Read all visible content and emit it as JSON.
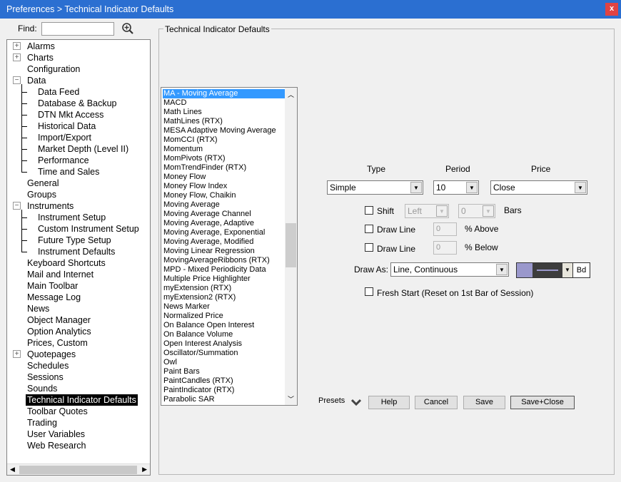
{
  "window": {
    "title": "Preferences > Technical Indicator Defaults",
    "close_label": "x"
  },
  "find": {
    "label": "Find:",
    "value": "",
    "icon": "zoom-in-icon"
  },
  "tree": [
    {
      "label": "Alarms",
      "level": 0,
      "expander": "+"
    },
    {
      "label": "Charts",
      "level": 0,
      "expander": "+"
    },
    {
      "label": "Configuration",
      "level": 0
    },
    {
      "label": "Data",
      "level": 0,
      "expander": "-"
    },
    {
      "label": "Data Feed",
      "level": 1
    },
    {
      "label": "Database & Backup",
      "level": 1
    },
    {
      "label": "DTN Mkt Access",
      "level": 1
    },
    {
      "label": "Historical Data",
      "level": 1
    },
    {
      "label": "Import/Export",
      "level": 1
    },
    {
      "label": "Market Depth (Level II)",
      "level": 1
    },
    {
      "label": "Performance",
      "level": 1
    },
    {
      "label": "Time and Sales",
      "level": 1
    },
    {
      "label": "General",
      "level": 0
    },
    {
      "label": "Groups",
      "level": 0
    },
    {
      "label": "Instruments",
      "level": 0,
      "expander": "-"
    },
    {
      "label": "Instrument Setup",
      "level": 1
    },
    {
      "label": "Custom Instrument Setup",
      "level": 1
    },
    {
      "label": "Future Type Setup",
      "level": 1
    },
    {
      "label": "Instrument Defaults",
      "level": 1
    },
    {
      "label": "Keyboard Shortcuts",
      "level": 0
    },
    {
      "label": "Mail and Internet",
      "level": 0
    },
    {
      "label": "Main Toolbar",
      "level": 0
    },
    {
      "label": "Message Log",
      "level": 0
    },
    {
      "label": "News",
      "level": 0
    },
    {
      "label": "Object Manager",
      "level": 0
    },
    {
      "label": "Option Analytics",
      "level": 0
    },
    {
      "label": "Prices, Custom",
      "level": 0
    },
    {
      "label": "Quotepages",
      "level": 0,
      "expander": "+"
    },
    {
      "label": "Schedules",
      "level": 0
    },
    {
      "label": "Sessions",
      "level": 0
    },
    {
      "label": "Sounds",
      "level": 0
    },
    {
      "label": "Technical Indicator Defaults",
      "level": 0,
      "selected": true
    },
    {
      "label": "Toolbar Quotes",
      "level": 0
    },
    {
      "label": "Trading",
      "level": 0
    },
    {
      "label": "User Variables",
      "level": 0
    },
    {
      "label": "Web Research",
      "level": 0
    }
  ],
  "group_title": "Technical Indicator Defaults",
  "indicators": {
    "selected": "MA - Moving Average",
    "items": [
      "MA - Moving Average",
      "MACD",
      "Math Lines",
      "MathLines (RTX)",
      "MESA Adaptive Moving Average",
      "MomCCI (RTX)",
      "Momentum",
      "MomPivots (RTX)",
      "MomTrendFinder (RTX)",
      "Money Flow",
      "Money Flow Index",
      "Money Flow, Chaikin",
      "Moving Average",
      "Moving Average Channel",
      "Moving Average, Adaptive",
      "Moving Average, Exponential",
      "Moving Average, Modified",
      "Moving Linear Regression",
      "MovingAverageRibbons (RTX)",
      "MPD - Mixed Periodicity Data",
      "Multiple Price Highlighter",
      "myExtension (RTX)",
      "myExtension2 (RTX)",
      "News Marker",
      "Normalized Price",
      "On Balance Open Interest",
      "On Balance Volume",
      "Open Interest Analysis",
      "Oscillator/Summation",
      "Owl",
      "Paint Bars",
      "PaintCandles (RTX)",
      "PaintIndicator (RTX)",
      "Parabolic SAR"
    ]
  },
  "settings": {
    "type_label": "Type",
    "type_value": "Simple",
    "period_label": "Period",
    "period_value": "10",
    "price_label": "Price",
    "price_value": "Close",
    "shift_label": "Shift",
    "shift_dir": "Left",
    "shift_bars": "0",
    "bars_label": "Bars",
    "drawline_label": "Draw Line",
    "above_value": "0",
    "above_label": "% Above",
    "below_value": "0",
    "below_label": "% Below",
    "drawas_label": "Draw As:",
    "drawas_value": "Line, Continuous",
    "color": "#9a98cc",
    "bold_label": "Bd",
    "fresh_label": "Fresh Start  (Reset on 1st Bar of Session)"
  },
  "buttons": {
    "presets": "Presets",
    "help": "Help",
    "cancel": "Cancel",
    "save": "Save",
    "save_close": "Save+Close"
  }
}
